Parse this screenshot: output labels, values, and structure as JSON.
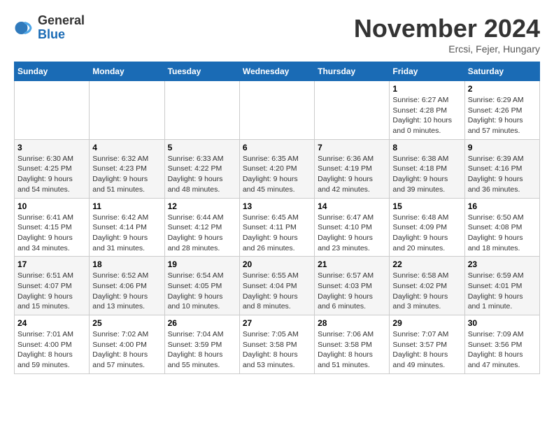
{
  "header": {
    "logo": {
      "line1": "General",
      "line2": "Blue"
    },
    "title": "November 2024",
    "location": "Ercsi, Fejer, Hungary"
  },
  "weekdays": [
    "Sunday",
    "Monday",
    "Tuesday",
    "Wednesday",
    "Thursday",
    "Friday",
    "Saturday"
  ],
  "weeks": [
    [
      {
        "day": "",
        "sunrise": "",
        "sunset": "",
        "daylight": ""
      },
      {
        "day": "",
        "sunrise": "",
        "sunset": "",
        "daylight": ""
      },
      {
        "day": "",
        "sunrise": "",
        "sunset": "",
        "daylight": ""
      },
      {
        "day": "",
        "sunrise": "",
        "sunset": "",
        "daylight": ""
      },
      {
        "day": "",
        "sunrise": "",
        "sunset": "",
        "daylight": ""
      },
      {
        "day": "1",
        "sunrise": "Sunrise: 6:27 AM",
        "sunset": "Sunset: 4:28 PM",
        "daylight": "Daylight: 10 hours and 0 minutes."
      },
      {
        "day": "2",
        "sunrise": "Sunrise: 6:29 AM",
        "sunset": "Sunset: 4:26 PM",
        "daylight": "Daylight: 9 hours and 57 minutes."
      }
    ],
    [
      {
        "day": "3",
        "sunrise": "Sunrise: 6:30 AM",
        "sunset": "Sunset: 4:25 PM",
        "daylight": "Daylight: 9 hours and 54 minutes."
      },
      {
        "day": "4",
        "sunrise": "Sunrise: 6:32 AM",
        "sunset": "Sunset: 4:23 PM",
        "daylight": "Daylight: 9 hours and 51 minutes."
      },
      {
        "day": "5",
        "sunrise": "Sunrise: 6:33 AM",
        "sunset": "Sunset: 4:22 PM",
        "daylight": "Daylight: 9 hours and 48 minutes."
      },
      {
        "day": "6",
        "sunrise": "Sunrise: 6:35 AM",
        "sunset": "Sunset: 4:20 PM",
        "daylight": "Daylight: 9 hours and 45 minutes."
      },
      {
        "day": "7",
        "sunrise": "Sunrise: 6:36 AM",
        "sunset": "Sunset: 4:19 PM",
        "daylight": "Daylight: 9 hours and 42 minutes."
      },
      {
        "day": "8",
        "sunrise": "Sunrise: 6:38 AM",
        "sunset": "Sunset: 4:18 PM",
        "daylight": "Daylight: 9 hours and 39 minutes."
      },
      {
        "day": "9",
        "sunrise": "Sunrise: 6:39 AM",
        "sunset": "Sunset: 4:16 PM",
        "daylight": "Daylight: 9 hours and 36 minutes."
      }
    ],
    [
      {
        "day": "10",
        "sunrise": "Sunrise: 6:41 AM",
        "sunset": "Sunset: 4:15 PM",
        "daylight": "Daylight: 9 hours and 34 minutes."
      },
      {
        "day": "11",
        "sunrise": "Sunrise: 6:42 AM",
        "sunset": "Sunset: 4:14 PM",
        "daylight": "Daylight: 9 hours and 31 minutes."
      },
      {
        "day": "12",
        "sunrise": "Sunrise: 6:44 AM",
        "sunset": "Sunset: 4:12 PM",
        "daylight": "Daylight: 9 hours and 28 minutes."
      },
      {
        "day": "13",
        "sunrise": "Sunrise: 6:45 AM",
        "sunset": "Sunset: 4:11 PM",
        "daylight": "Daylight: 9 hours and 26 minutes."
      },
      {
        "day": "14",
        "sunrise": "Sunrise: 6:47 AM",
        "sunset": "Sunset: 4:10 PM",
        "daylight": "Daylight: 9 hours and 23 minutes."
      },
      {
        "day": "15",
        "sunrise": "Sunrise: 6:48 AM",
        "sunset": "Sunset: 4:09 PM",
        "daylight": "Daylight: 9 hours and 20 minutes."
      },
      {
        "day": "16",
        "sunrise": "Sunrise: 6:50 AM",
        "sunset": "Sunset: 4:08 PM",
        "daylight": "Daylight: 9 hours and 18 minutes."
      }
    ],
    [
      {
        "day": "17",
        "sunrise": "Sunrise: 6:51 AM",
        "sunset": "Sunset: 4:07 PM",
        "daylight": "Daylight: 9 hours and 15 minutes."
      },
      {
        "day": "18",
        "sunrise": "Sunrise: 6:52 AM",
        "sunset": "Sunset: 4:06 PM",
        "daylight": "Daylight: 9 hours and 13 minutes."
      },
      {
        "day": "19",
        "sunrise": "Sunrise: 6:54 AM",
        "sunset": "Sunset: 4:05 PM",
        "daylight": "Daylight: 9 hours and 10 minutes."
      },
      {
        "day": "20",
        "sunrise": "Sunrise: 6:55 AM",
        "sunset": "Sunset: 4:04 PM",
        "daylight": "Daylight: 9 hours and 8 minutes."
      },
      {
        "day": "21",
        "sunrise": "Sunrise: 6:57 AM",
        "sunset": "Sunset: 4:03 PM",
        "daylight": "Daylight: 9 hours and 6 minutes."
      },
      {
        "day": "22",
        "sunrise": "Sunrise: 6:58 AM",
        "sunset": "Sunset: 4:02 PM",
        "daylight": "Daylight: 9 hours and 3 minutes."
      },
      {
        "day": "23",
        "sunrise": "Sunrise: 6:59 AM",
        "sunset": "Sunset: 4:01 PM",
        "daylight": "Daylight: 9 hours and 1 minute."
      }
    ],
    [
      {
        "day": "24",
        "sunrise": "Sunrise: 7:01 AM",
        "sunset": "Sunset: 4:00 PM",
        "daylight": "Daylight: 8 hours and 59 minutes."
      },
      {
        "day": "25",
        "sunrise": "Sunrise: 7:02 AM",
        "sunset": "Sunset: 4:00 PM",
        "daylight": "Daylight: 8 hours and 57 minutes."
      },
      {
        "day": "26",
        "sunrise": "Sunrise: 7:04 AM",
        "sunset": "Sunset: 3:59 PM",
        "daylight": "Daylight: 8 hours and 55 minutes."
      },
      {
        "day": "27",
        "sunrise": "Sunrise: 7:05 AM",
        "sunset": "Sunset: 3:58 PM",
        "daylight": "Daylight: 8 hours and 53 minutes."
      },
      {
        "day": "28",
        "sunrise": "Sunrise: 7:06 AM",
        "sunset": "Sunset: 3:58 PM",
        "daylight": "Daylight: 8 hours and 51 minutes."
      },
      {
        "day": "29",
        "sunrise": "Sunrise: 7:07 AM",
        "sunset": "Sunset: 3:57 PM",
        "daylight": "Daylight: 8 hours and 49 minutes."
      },
      {
        "day": "30",
        "sunrise": "Sunrise: 7:09 AM",
        "sunset": "Sunset: 3:56 PM",
        "daylight": "Daylight: 8 hours and 47 minutes."
      }
    ]
  ]
}
